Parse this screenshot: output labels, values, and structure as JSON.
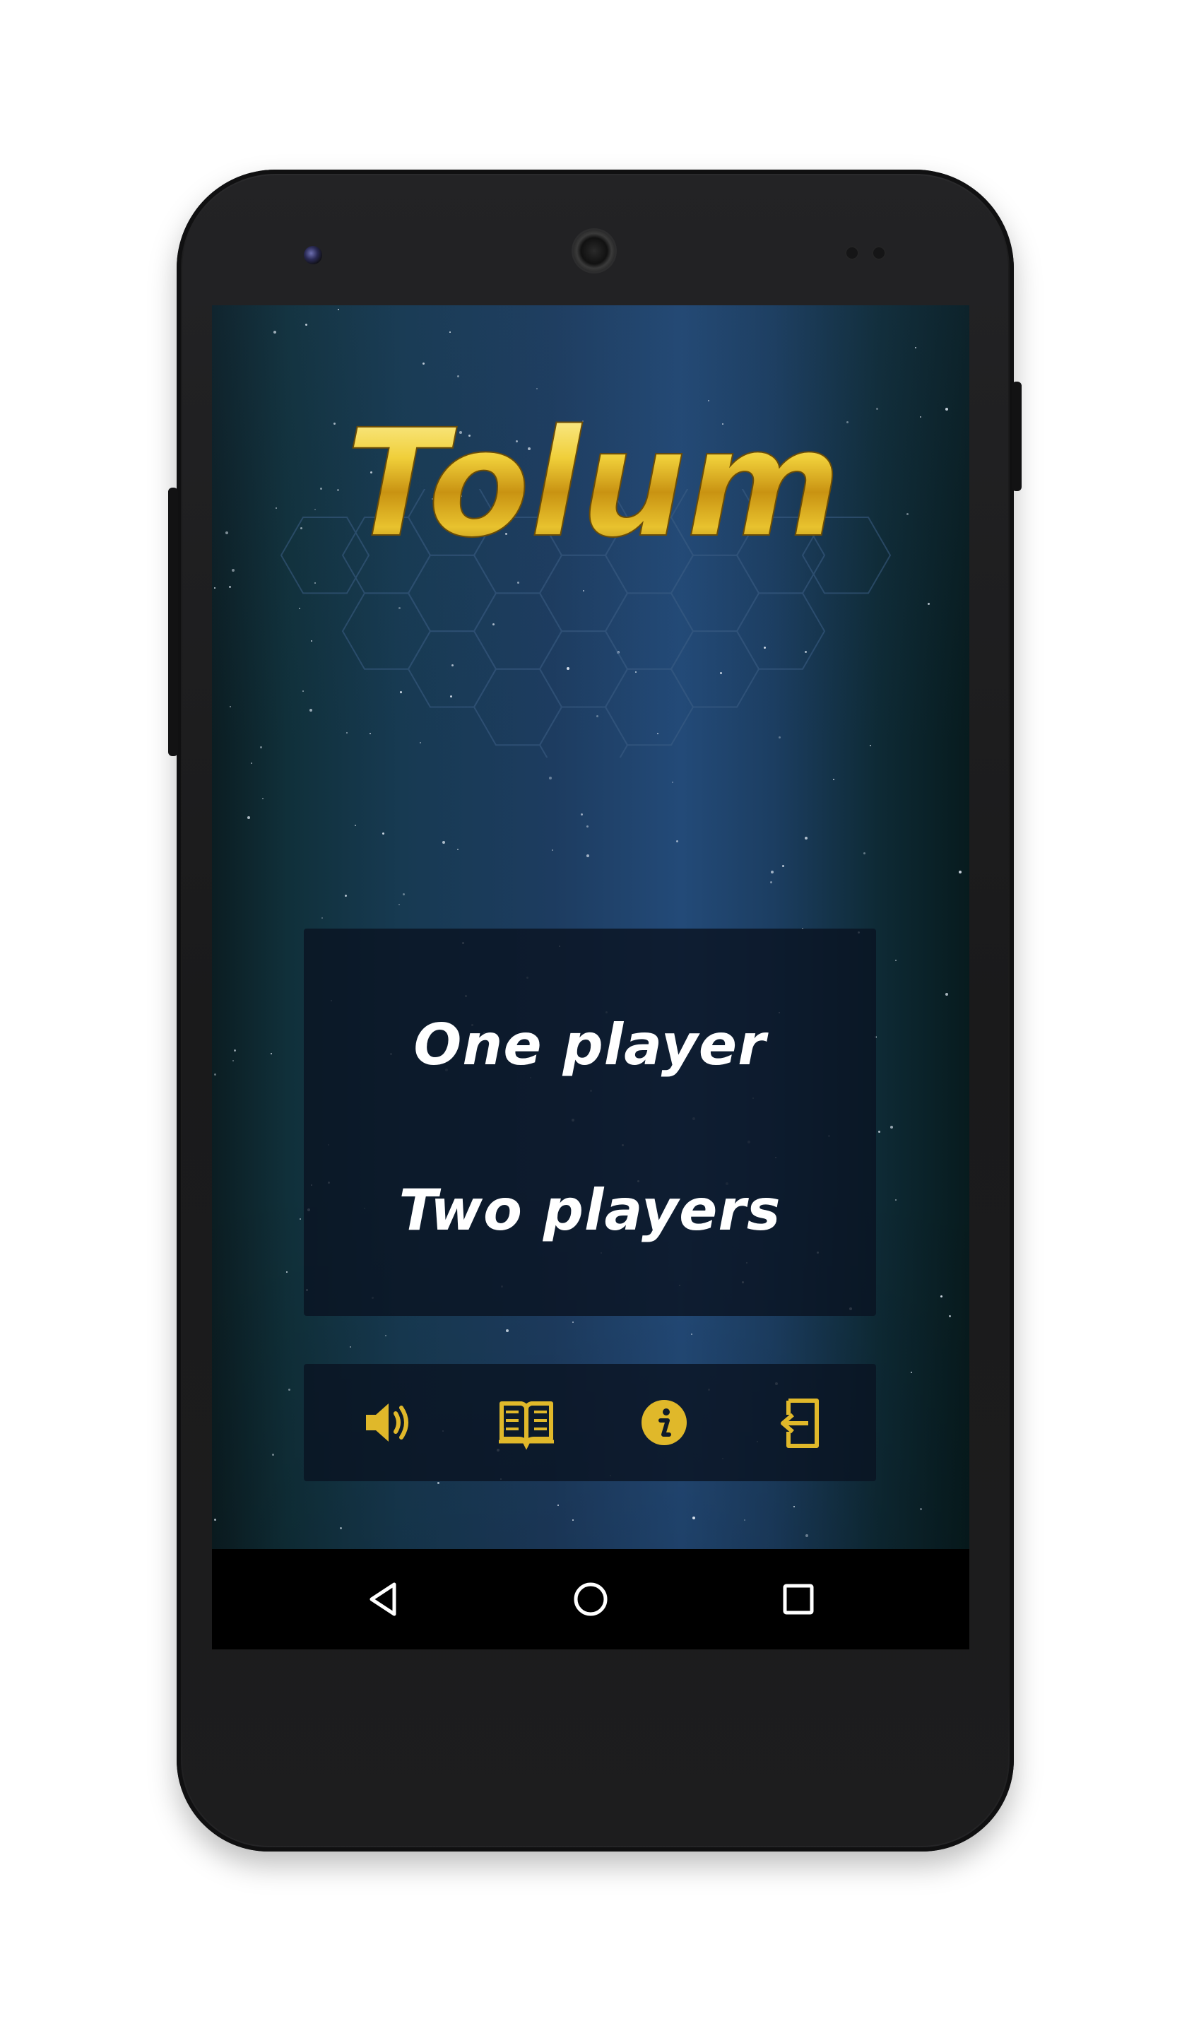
{
  "game": {
    "title": "Tolum"
  },
  "menu": {
    "one_player": "One player",
    "two_players": "Two players"
  },
  "toolbar": {
    "icons": [
      "sound-icon",
      "book-icon",
      "info-icon",
      "exit-icon"
    ]
  },
  "navigation": {
    "icons": [
      "back-icon",
      "home-icon",
      "recent-apps-icon"
    ]
  },
  "colors": {
    "accent_gold": "#e0b82a",
    "menu_text": "#ffffff",
    "panel_bg": "#0a1422",
    "nav_bar": "#000000"
  }
}
